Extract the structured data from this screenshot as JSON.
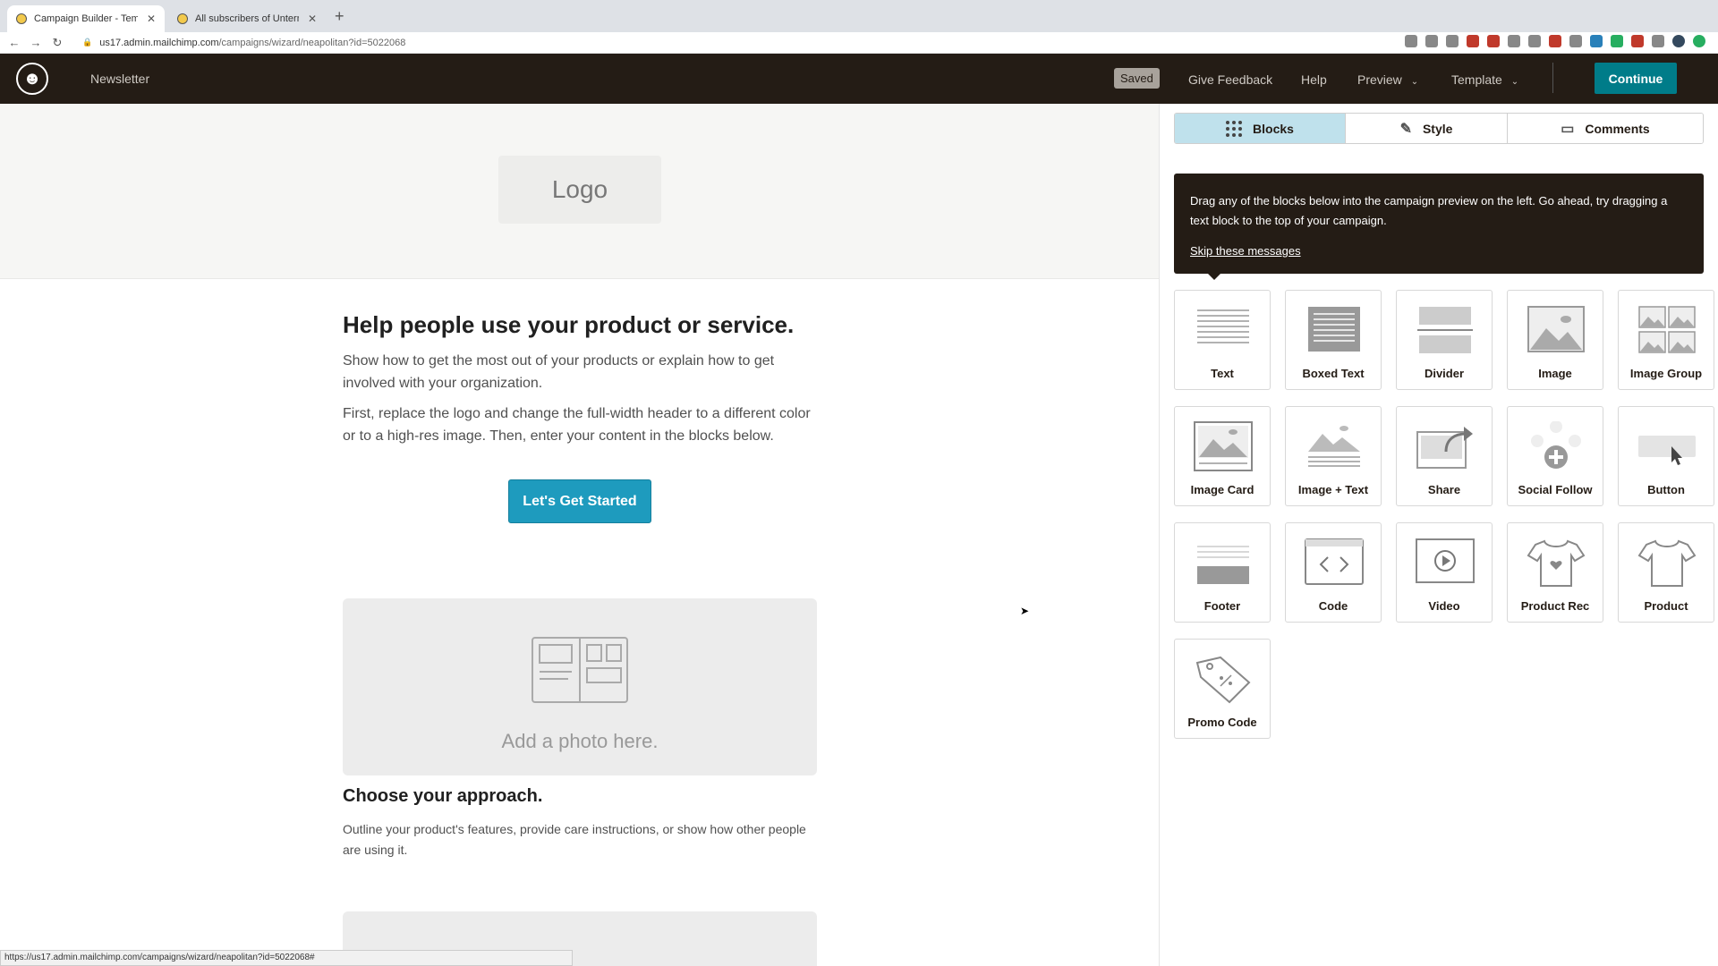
{
  "browser": {
    "tabs": [
      {
        "title": "Campaign Builder - Template D",
        "active": true
      },
      {
        "title": "All subscribers of Unternehmen",
        "active": false
      }
    ],
    "url_host": "us17.admin.mailchimp.com",
    "url_path": "/campaigns/wizard/neapolitan?id=5022068",
    "status_url": "https://us17.admin.mailchimp.com/campaigns/wizard/neapolitan?id=5022068#"
  },
  "header": {
    "campaign_name": "Newsletter",
    "saved_label": "Saved",
    "feedback_label": "Give Feedback",
    "help_label": "Help",
    "preview_label": "Preview",
    "template_label": "Template",
    "continue_label": "Continue"
  },
  "preview": {
    "logo_placeholder": "Logo",
    "heading": "Help people use your product or service.",
    "para1": "Show how to get the most out of your products or explain how to get involved with your organization.",
    "para2": "First, replace the logo and change the full-width header to a different color or to a high-res image. Then, enter your content in the blocks below.",
    "cta_label": "Let's Get Started",
    "photo_placeholder": "Add a photo here.",
    "heading2": "Choose your approach.",
    "para3": "Outline your product's features, provide care instructions, or show how other people are using it."
  },
  "panel": {
    "tabs": [
      {
        "label": "Blocks",
        "active": true,
        "icon": "grid-icon"
      },
      {
        "label": "Style",
        "active": false,
        "icon": "brush-icon"
      },
      {
        "label": "Comments",
        "active": false,
        "icon": "comment-icon"
      }
    ],
    "tip_text": "Drag any of the blocks below into the campaign preview on the left. Go ahead, try dragging a text block to the top of your campaign.",
    "tip_link": "Skip these messages",
    "blocks": [
      {
        "label": "Text",
        "icon": "text-block-icon"
      },
      {
        "label": "Boxed Text",
        "icon": "boxed-text-icon"
      },
      {
        "label": "Divider",
        "icon": "divider-icon"
      },
      {
        "label": "Image",
        "icon": "image-icon"
      },
      {
        "label": "Image Group",
        "icon": "image-group-icon"
      },
      {
        "label": "Image Card",
        "icon": "image-card-icon"
      },
      {
        "label": "Image + Text",
        "icon": "image-text-icon"
      },
      {
        "label": "Share",
        "icon": "share-icon"
      },
      {
        "label": "Social Follow",
        "icon": "social-follow-icon"
      },
      {
        "label": "Button",
        "icon": "button-icon"
      },
      {
        "label": "Footer",
        "icon": "footer-icon"
      },
      {
        "label": "Code",
        "icon": "code-icon"
      },
      {
        "label": "Video",
        "icon": "video-icon"
      },
      {
        "label": "Product Rec",
        "icon": "product-rec-icon"
      },
      {
        "label": "Product",
        "icon": "product-icon"
      },
      {
        "label": "Promo Code",
        "icon": "promo-code-icon"
      }
    ]
  },
  "colors": {
    "app_bar": "#241c15",
    "continue": "#007c89",
    "cta": "#1e9bbe",
    "active_tab": "#bfe1ec"
  }
}
